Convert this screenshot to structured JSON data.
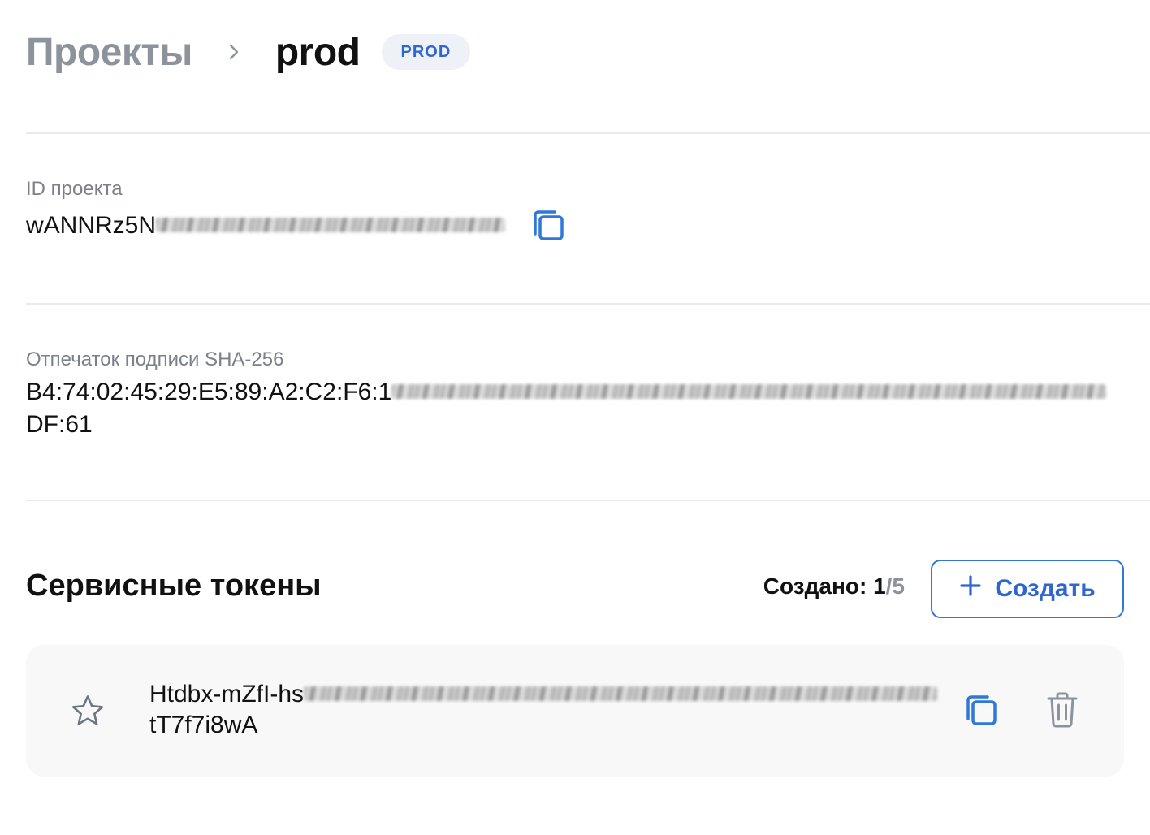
{
  "breadcrumb": {
    "root": "Проекты",
    "current": "prod",
    "badge": "PROD"
  },
  "project_id": {
    "label": "ID проекта",
    "value_visible": "wANNRz5N"
  },
  "signature": {
    "label": "Отпечаток подписи SHA-256",
    "value_visible": "B4:74:02:45:29:E5:89:A2:C2:F6:1",
    "value_tail": "DF:61"
  },
  "service_tokens": {
    "title": "Сервисные токены",
    "created_label": "Создано:",
    "created_count": "1",
    "created_max": "/5",
    "create_button_label": "Создать",
    "tokens": [
      {
        "value_visible": "Htdbx-mZfI-hs",
        "value_tail": "tT7f7i8wA"
      }
    ]
  },
  "colors": {
    "accent": "#2f66d0",
    "muted_text": "#8d939b",
    "card_background": "#f8f8f9",
    "badge_background": "#eef2f8"
  },
  "icons": {
    "breadcrumb_separator": "chevron-right-icon",
    "copy": "copy-icon",
    "favorite": "star-outline-icon",
    "delete": "trash-icon",
    "create": "plus-icon"
  }
}
